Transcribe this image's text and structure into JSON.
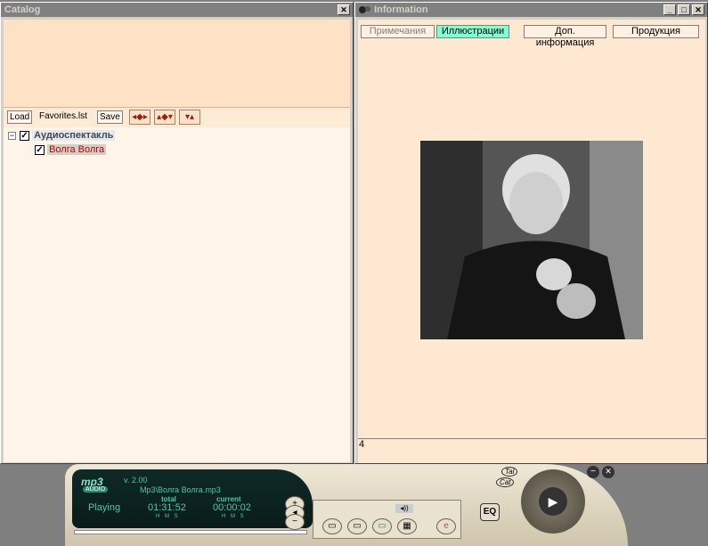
{
  "catalog": {
    "title": "Catalog",
    "toolbar": {
      "load": "Load",
      "file": "Favorites.lst",
      "save": "Save"
    },
    "tree": {
      "root": "Аудиоспектакль",
      "child": "Волга Волга"
    }
  },
  "info": {
    "title": "Information",
    "tabs": [
      "Примечания",
      "Иллюстрации",
      "Доп. информация",
      "Продукция"
    ],
    "active_tab": "Иллюстрации",
    "status_value": "4"
  },
  "player": {
    "logo": "mp3",
    "audio_label": "AUDIO",
    "version": "v. 2.00",
    "file": "Mp3\\Волга Волга.mp3",
    "state": "Playing",
    "total_label": "total",
    "current_label": "current",
    "total_time": "01:31:52",
    "current_time": "00:00:02",
    "hms": "H M S",
    "eq": "EQ",
    "tal": "Tal",
    "cat": "Cat"
  },
  "colors": {
    "accent_tab": "#7fffd4",
    "lcd_text": "#49c9ad",
    "child_text": "#c00000"
  }
}
